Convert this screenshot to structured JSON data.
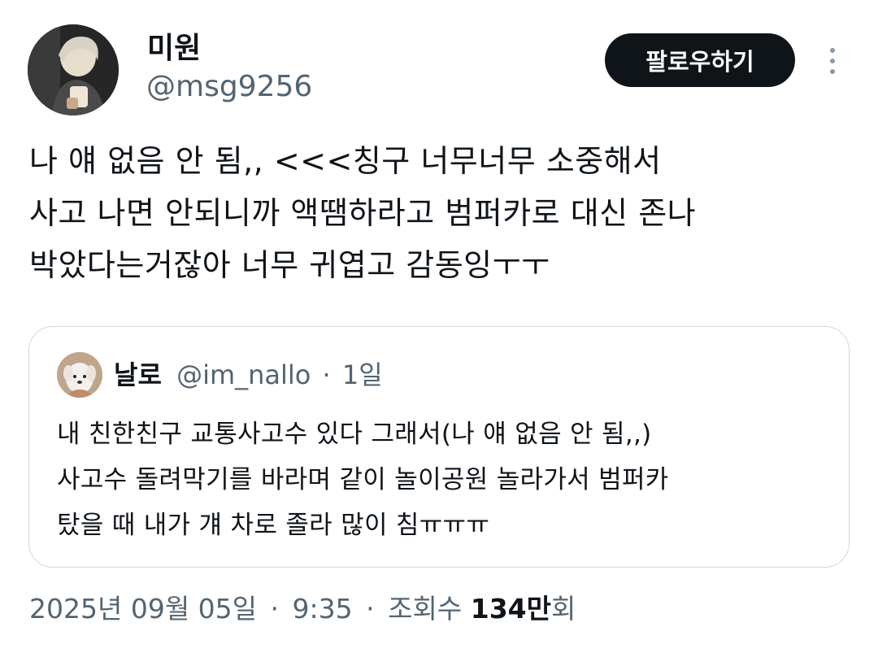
{
  "author": {
    "display_name": "미원",
    "handle": "@msg9256",
    "avatar_icon": "profile-photo"
  },
  "follow_button": {
    "label": "팔로우하기"
  },
  "more_button": {
    "icon": "more-vertical-icon"
  },
  "tweet": {
    "lines": [
      "나 얘 없음 안 됨,, <<<칭구 너무너무 소중해서",
      "사고 나면 안되니까 액땜하라고 범퍼카로 대신 존나",
      "박았다는거잖아 너무 귀엽고 감동잉ㅜㅜ"
    ]
  },
  "quote": {
    "display_name": "날로",
    "handle": "@im_nallo",
    "separator": "·",
    "time": "1일",
    "avatar_icon": "dog-photo",
    "lines": [
      "내 친한친구 교통사고수 있다 그래서(나 얘 없음 안 됨,,)",
      "사고수 돌려막기를 바라며 같이 놀이공원 놀라가서 범퍼카",
      "탔을 때 내가 걔 차로 졸라 많이 침ㅠㅠㅠ"
    ]
  },
  "meta": {
    "date": "2025년 09월 05일",
    "separator": "·",
    "time": "9:35",
    "views_label": "조회수",
    "views_count": "134만",
    "views_unit": "회"
  },
  "colors": {
    "text": "#0f1419",
    "secondary": "#536471",
    "border": "#cfd9de",
    "button_bg": "#0f1419",
    "button_text": "#ffffff"
  }
}
